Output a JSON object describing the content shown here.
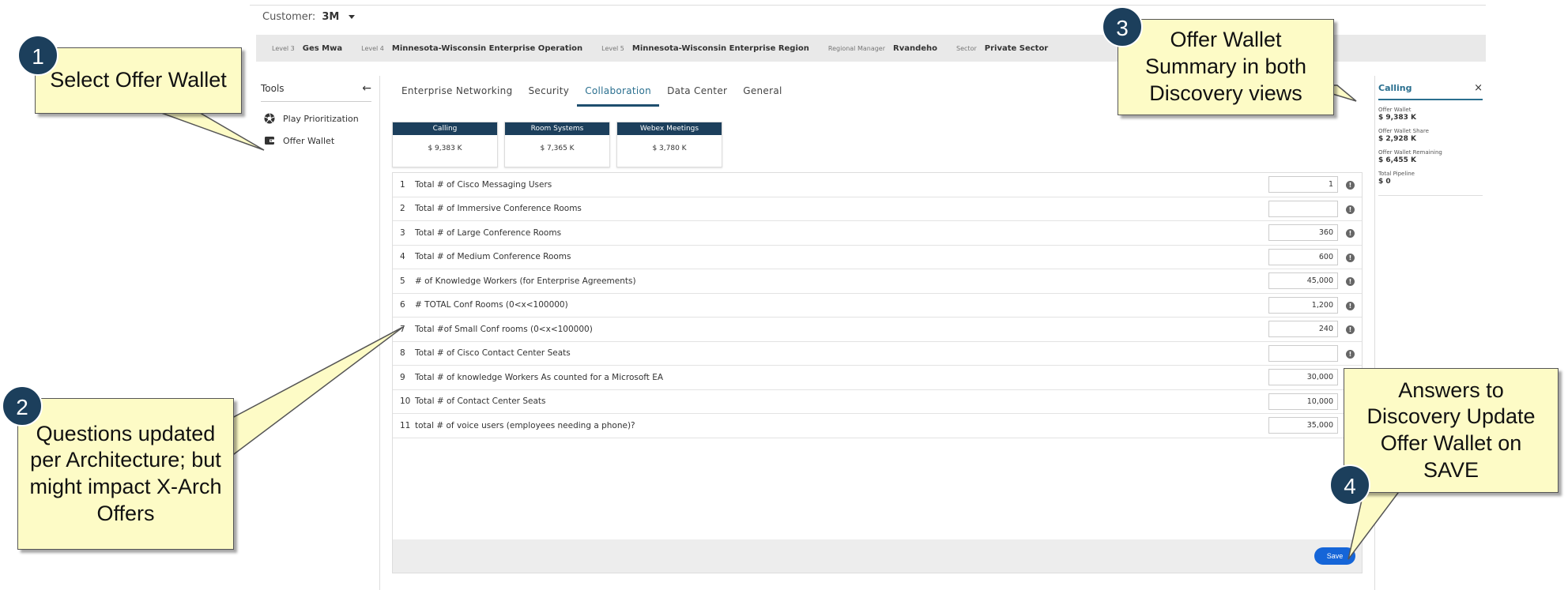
{
  "customer": {
    "label": "Customer:",
    "value": "3M"
  },
  "breadcrumb": [
    {
      "key": "Level 3",
      "value": "Ges Mwa"
    },
    {
      "key": "Level 4",
      "value": "Minnesota-Wisconsin Enterprise Operation"
    },
    {
      "key": "Level 5",
      "value": "Minnesota-Wisconsin Enterprise Region"
    },
    {
      "key": "Regional Manager",
      "value": "Rvandeho"
    },
    {
      "key": "Sector",
      "value": "Private Sector"
    }
  ],
  "tools": {
    "title": "Tools",
    "items": [
      {
        "label": "Play Prioritization",
        "icon": "aperture-icon"
      },
      {
        "label": "Offer Wallet",
        "icon": "wallet-icon"
      }
    ]
  },
  "tabs": [
    "Enterprise Networking",
    "Security",
    "Collaboration",
    "Data Center",
    "General"
  ],
  "active_tab": "Collaboration",
  "tiles": [
    {
      "title": "Calling",
      "value": "$ 9,383 K"
    },
    {
      "title": "Room Systems",
      "value": "$ 7,365 K"
    },
    {
      "title": "Webex Meetings",
      "value": "$ 3,780 K"
    }
  ],
  "questions": [
    {
      "num": "1",
      "text": "Total # of Cisco Messaging Users",
      "value": "1",
      "info": true
    },
    {
      "num": "2",
      "text": "Total # of Immersive Conference Rooms",
      "value": "",
      "info": true
    },
    {
      "num": "3",
      "text": "Total # of Large Conference Rooms",
      "value": "360",
      "info": true
    },
    {
      "num": "4",
      "text": "Total # of Medium Conference Rooms",
      "value": "600",
      "info": true
    },
    {
      "num": "5",
      "text": "# of Knowledge Workers (for Enterprise Agreements)",
      "value": "45,000",
      "info": true
    },
    {
      "num": "6",
      "text": "# TOTAL Conf Rooms (0<x<100000)",
      "value": "1,200",
      "info": true
    },
    {
      "num": "7",
      "text": "Total #of Small Conf rooms (0<x<100000)",
      "value": "240",
      "info": true
    },
    {
      "num": "8",
      "text": "Total # of Cisco Contact Center Seats",
      "value": "",
      "info": true
    },
    {
      "num": "9",
      "text": "Total # of knowledge Workers As counted for a Microsoft EA",
      "value": "30,000",
      "info": false
    },
    {
      "num": "10",
      "text": "Total # of Contact Center Seats",
      "value": "10,000",
      "info": false
    },
    {
      "num": "11",
      "text": "total # of voice users (employees needing a phone)?",
      "value": "35,000",
      "info": false
    }
  ],
  "save_label": "Save",
  "panel": {
    "title": "Calling",
    "items": [
      {
        "label": "Offer Wallet",
        "value": "$ 9,383 K"
      },
      {
        "label": "Offer Wallet Share",
        "value": "$ 2,928 K"
      },
      {
        "label": "Offer Wallet Remaining",
        "value": "$ 6,455 K"
      },
      {
        "label": "Total Pipeline",
        "value": "$ 0"
      }
    ]
  },
  "callouts": [
    {
      "badge": "1",
      "text": "Select Offer Wallet"
    },
    {
      "badge": "2",
      "text": "Questions updated per Architecture; but might impact X-Arch Offers"
    },
    {
      "badge": "3",
      "text": "Offer Wallet Summary in both Discovery views"
    },
    {
      "badge": "4",
      "text": "Answers to Discovery Update Offer Wallet on SAVE"
    }
  ],
  "colors": {
    "accent": "#1c3f5c",
    "tab_active": "#2a6f8f",
    "save": "#1565d8",
    "callout_bg": "#fdfbc6"
  }
}
